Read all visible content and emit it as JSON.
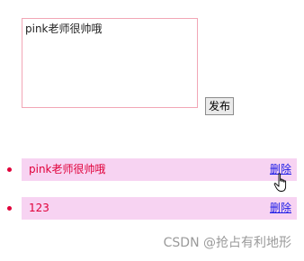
{
  "form": {
    "textarea_value": "pink老师很帅哦",
    "publish_label": "发布"
  },
  "comments": [
    {
      "text": "pink老师很帅哦",
      "delete_label": "删除"
    },
    {
      "text": "123",
      "delete_label": "删除"
    }
  ],
  "colors": {
    "item_background": "#f7d3f2",
    "item_text": "#e0003a",
    "link": "#1a1ae6",
    "textarea_border": "#f2a6b6"
  },
  "watermark": "CSDN @抢占有利地形"
}
